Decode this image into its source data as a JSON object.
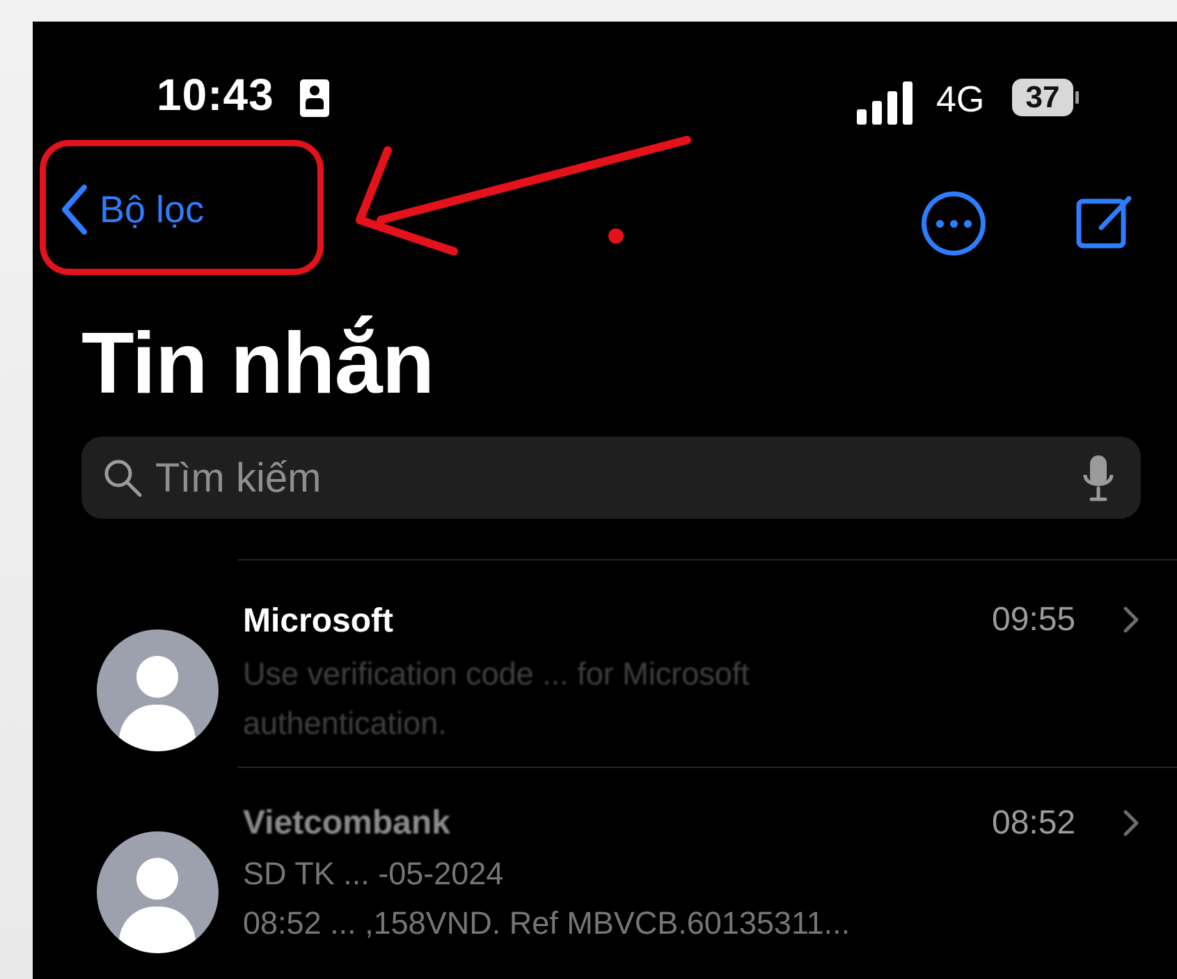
{
  "status_bar": {
    "time": "10:43",
    "network": "4G",
    "battery": "37"
  },
  "nav": {
    "back_label": "Bộ lọc"
  },
  "title": "Tin nhắn",
  "search": {
    "placeholder": "Tìm kiếm"
  },
  "messages": [
    {
      "sender": "Microsoft",
      "time": "09:55",
      "preview_line1": "Use verification code ... for Microsoft",
      "preview_line2": "authentication."
    },
    {
      "sender": "Vietcombank",
      "time": "08:52",
      "preview_line1": "SD TK ... -05-2024",
      "preview_line2": "08:52 ... ,158VND. Ref MBVCB.60135311..."
    }
  ],
  "colors": {
    "accent": "#2f7dff",
    "annotation": "#e3121b",
    "background": "#000000"
  },
  "icons": [
    "id-card-icon",
    "signal-icon",
    "battery-icon",
    "chevron-left-icon",
    "more-icon",
    "compose-icon",
    "search-icon",
    "mic-icon",
    "avatar-icon",
    "chevron-right-icon",
    "annotation-arrow-icon"
  ]
}
